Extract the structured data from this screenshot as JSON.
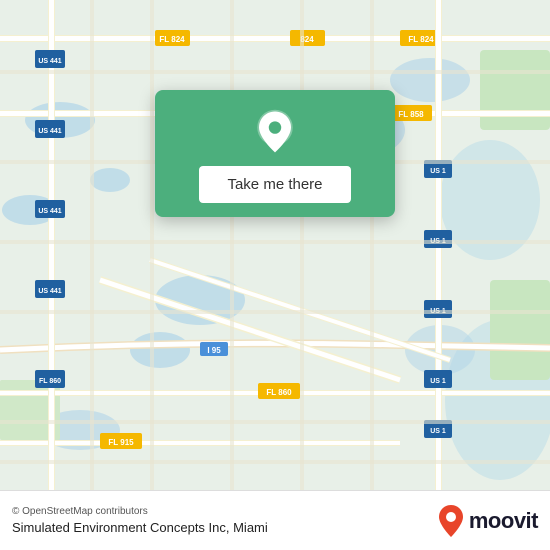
{
  "map": {
    "background_color": "#e8f0e8"
  },
  "popup": {
    "button_label": "Take me there",
    "background_color": "#4caf7d"
  },
  "bottom_bar": {
    "osm_credit": "© OpenStreetMap contributors",
    "location_name": "Simulated Environment Concepts Inc, Miami",
    "moovit_label": "moovit"
  }
}
